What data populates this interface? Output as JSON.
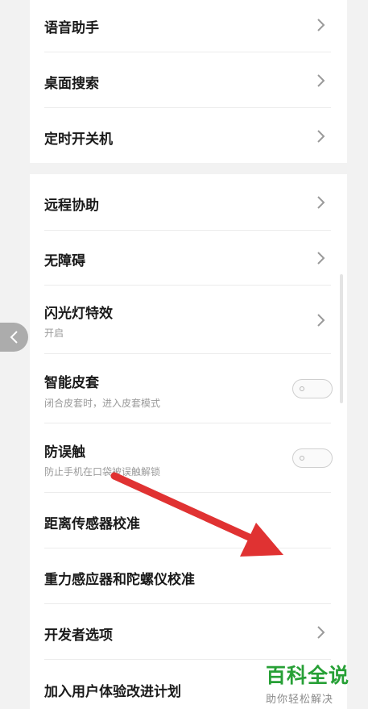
{
  "settings_group_1": [
    {
      "title": "语音助手",
      "type": "chevron"
    },
    {
      "title": "桌面搜索",
      "type": "chevron"
    },
    {
      "title": "定时开关机",
      "type": "chevron"
    }
  ],
  "settings_group_2": [
    {
      "title": "远程协助",
      "type": "chevron"
    },
    {
      "title": "无障碍",
      "type": "chevron"
    },
    {
      "title": "闪光灯特效",
      "subtitle": "开启",
      "type": "chevron"
    },
    {
      "title": "智能皮套",
      "subtitle": "闭合皮套时，进入皮套模式",
      "type": "toggle",
      "enabled": false
    },
    {
      "title": "防误触",
      "subtitle": "防止手机在口袋被误触解锁",
      "type": "toggle",
      "enabled": false
    },
    {
      "title": "距离传感器校准",
      "type": "none"
    },
    {
      "title": "重力感应器和陀螺仪校准",
      "type": "none"
    },
    {
      "title": "开发者选项",
      "type": "chevron"
    },
    {
      "title": "加入用户体验改进计划",
      "type": "none"
    }
  ],
  "watermark": {
    "main": "百科全说",
    "sub": "助你轻松解决"
  },
  "colors": {
    "arrow": "#e03232",
    "watermark": "#27a036",
    "background": "#f2f2f2"
  },
  "icons": {
    "back": "chevron-left-icon",
    "row_chevron": "chevron-right-icon"
  }
}
